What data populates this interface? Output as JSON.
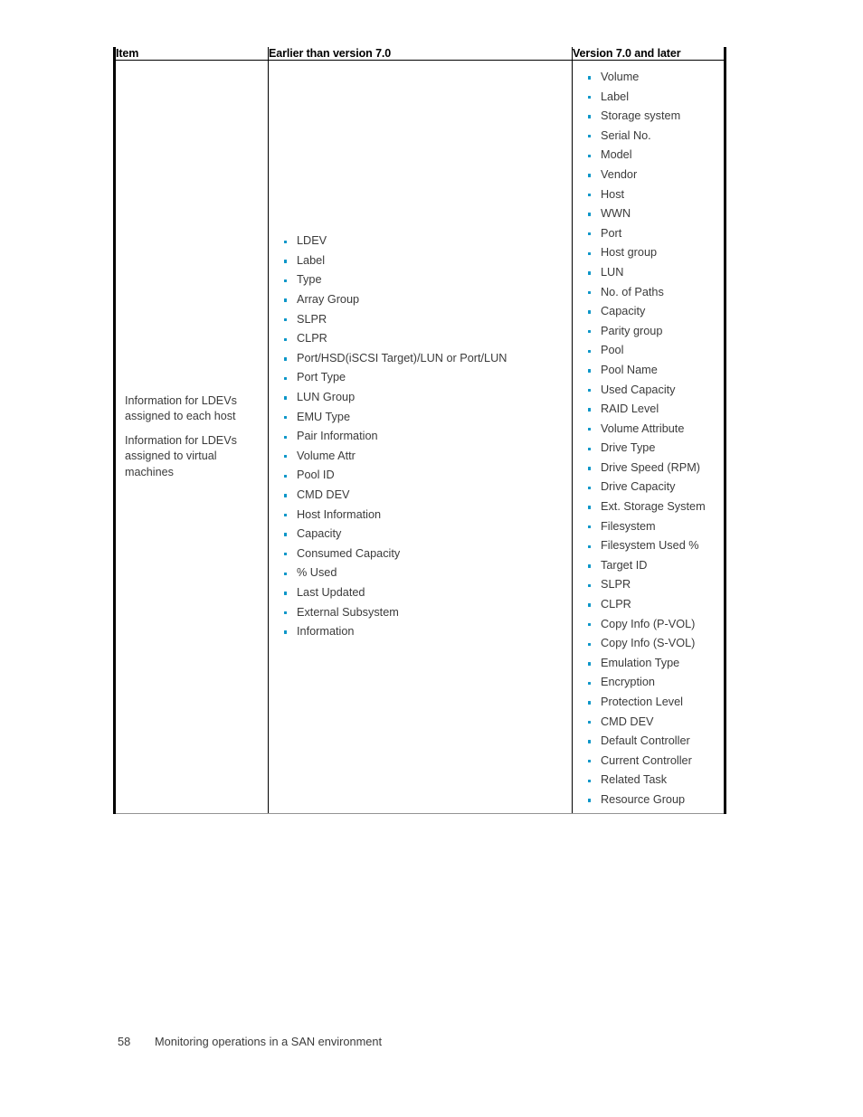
{
  "page": {
    "footer": {
      "page_number": "58",
      "title": "Monitoring operations in a SAN environment"
    }
  },
  "table": {
    "headers": {
      "item": "Item",
      "earlier": "Earlier than version 7.0",
      "version": "Version 7.0 and later"
    },
    "item_column": {
      "paragraphs": [
        "Information for LDEVs assigned to each host",
        "Information for LDEVs assigned to virtual machines"
      ]
    },
    "earlier_column": {
      "items": [
        "LDEV",
        "Label",
        "Type",
        "Array Group",
        "SLPR",
        "CLPR",
        "Port/HSD(iSCSI Target)/LUN or Port/LUN",
        "Port Type",
        "LUN Group",
        "EMU Type",
        "Pair Information",
        "Volume Attr",
        "Pool ID",
        "CMD DEV",
        "Host Information",
        "Capacity",
        "Consumed Capacity",
        "% Used",
        "Last Updated",
        "External Subsystem",
        "Information"
      ]
    },
    "version_column": {
      "items": [
        "Volume",
        "Label",
        "Storage system",
        "Serial No.",
        "Model",
        "Vendor",
        "Host",
        "WWN",
        "Port",
        "Host group",
        "LUN",
        "No. of Paths",
        "Capacity",
        "Parity group",
        "Pool",
        "Pool Name",
        "Used Capacity",
        "RAID Level",
        "Volume Attribute",
        "Drive Type",
        "Drive Speed (RPM)",
        "Drive Capacity",
        "Ext. Storage System",
        "Filesystem",
        "Filesystem Used %",
        "Target ID",
        "SLPR",
        "CLPR",
        "Copy Info (P-VOL)",
        "Copy Info (S-VOL)",
        "Emulation Type",
        "Encryption",
        "Protection Level",
        "CMD DEV",
        "Default Controller",
        "Current Controller",
        "Related Task",
        "Resource Group"
      ]
    }
  },
  "colors": {
    "bullet": "#0b96c8",
    "text": "#3b3b3b",
    "heading": "#000000",
    "rule_thick": "#000000",
    "rule_thin": "#939393"
  }
}
